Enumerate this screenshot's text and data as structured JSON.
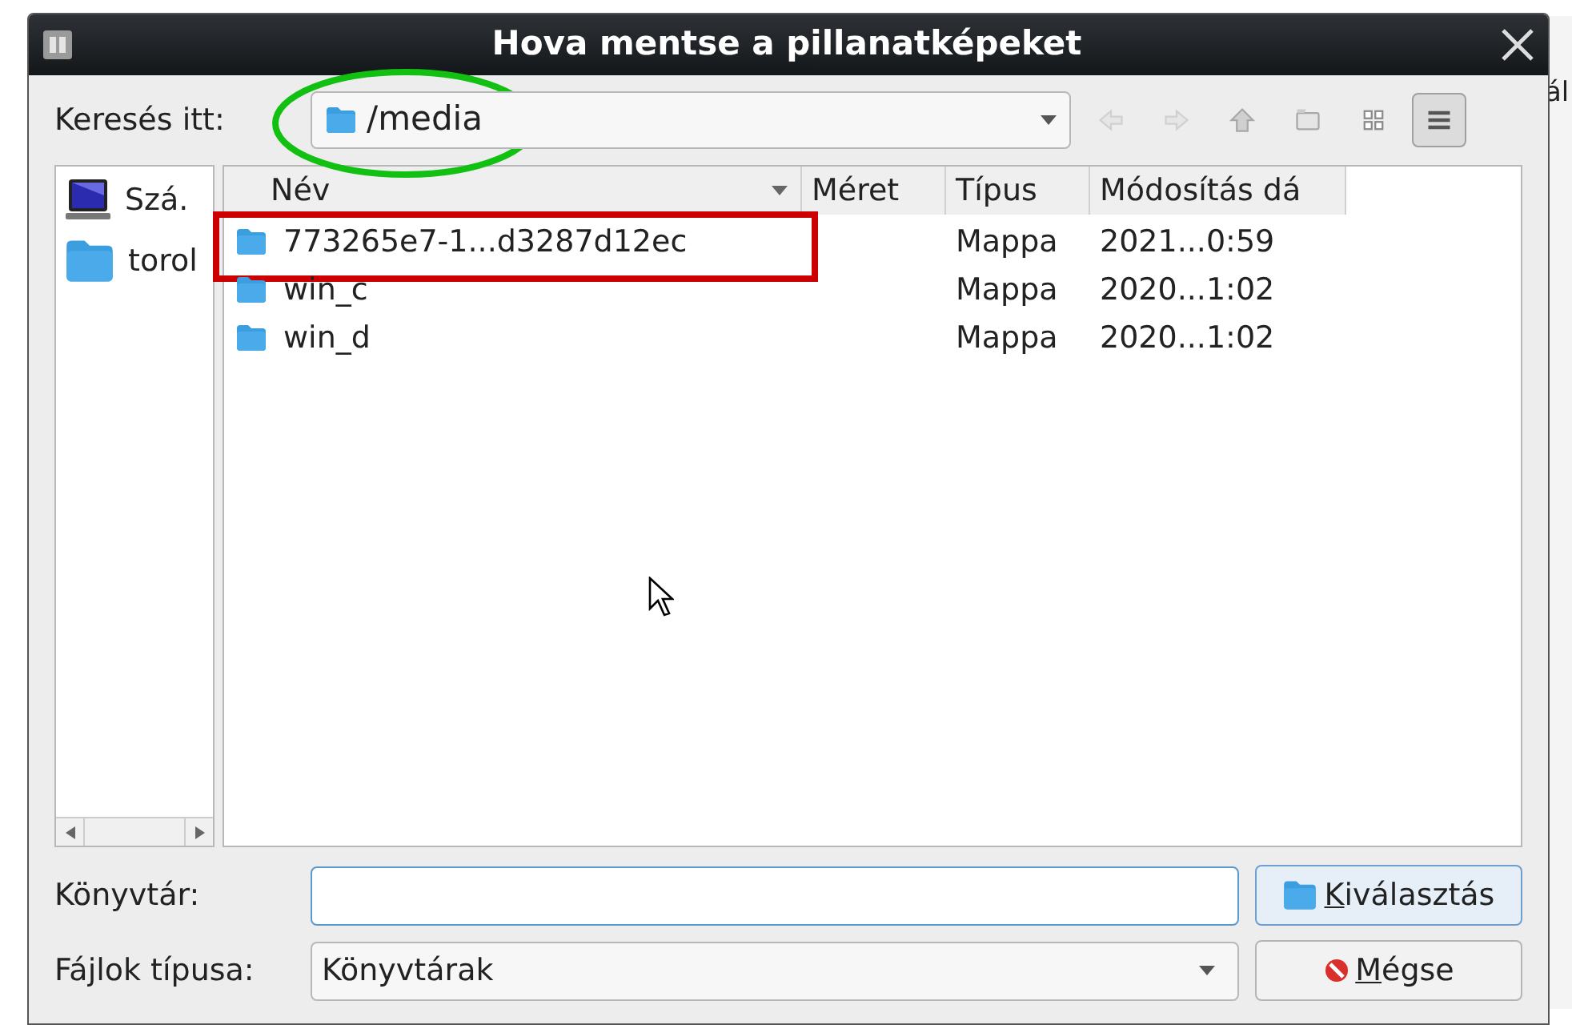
{
  "window": {
    "title": "Hova mentse a pillanatképeket"
  },
  "background_window": {
    "text": "ál"
  },
  "look_in": {
    "label": "Keresés itt:",
    "path": "/media"
  },
  "toolbar": [
    {
      "kind": "back",
      "disabled": true,
      "selected": false
    },
    {
      "kind": "forward",
      "disabled": true,
      "selected": false
    },
    {
      "kind": "up",
      "disabled": false,
      "selected": false
    },
    {
      "kind": "new-folder",
      "disabled": false,
      "selected": false
    },
    {
      "kind": "grid",
      "disabled": false,
      "selected": false
    },
    {
      "kind": "list",
      "disabled": false,
      "selected": true
    }
  ],
  "sidebar": {
    "items": [
      {
        "kind": "computer",
        "label": "Szá."
      },
      {
        "kind": "folder",
        "label": "torol"
      }
    ]
  },
  "table": {
    "columns": [
      {
        "label": "Név",
        "sorted": true
      },
      {
        "label": "Méret",
        "sorted": false
      },
      {
        "label": "Típus",
        "sorted": false
      },
      {
        "label": "Módosítás dá",
        "sorted": false
      }
    ],
    "rows": [
      {
        "name": "773265e7-1...d3287d12ec",
        "type": "Mappa",
        "modified": "2021...0:59",
        "highlighted": true
      },
      {
        "name": "win_c",
        "type": "Mappa",
        "modified": "2020...1:02",
        "highlighted": false
      },
      {
        "name": "win_d",
        "type": "Mappa",
        "modified": "2020...1:02",
        "highlighted": false
      }
    ]
  },
  "directory_field": {
    "label": "Könyvtár:"
  },
  "file_type": {
    "label": "Fájlok típusa:",
    "value": "Könyvtárak"
  },
  "buttons": [
    {
      "kind": "choose",
      "label": "Kiválasztás",
      "mnemonic_underlined": true
    },
    {
      "kind": "cancel",
      "label": "Mégse",
      "mnemonic_underlined": true
    }
  ],
  "annotations": {
    "path_circled": true
  }
}
